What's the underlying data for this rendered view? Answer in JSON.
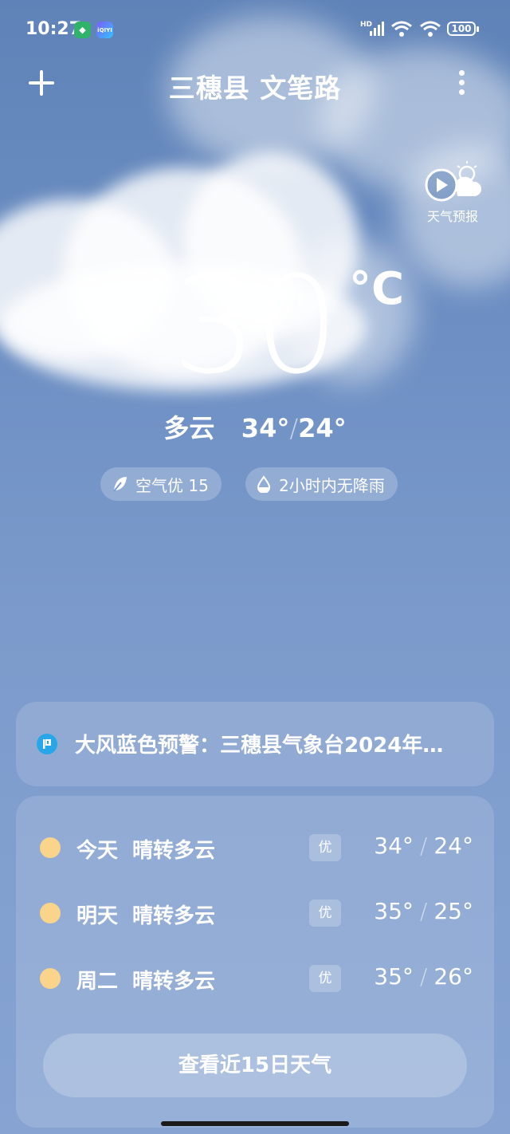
{
  "status_bar": {
    "time": "10:27",
    "app_badges": [
      "shield-app",
      "iQIYI"
    ],
    "signal_label": "HD",
    "battery": "100"
  },
  "header": {
    "location": "三穗县 文笔路"
  },
  "forecast_video": {
    "label": "天气预报"
  },
  "current": {
    "temperature": "30",
    "unit": "°C",
    "condition": "多云",
    "high": "34°",
    "low": "24°"
  },
  "pills": {
    "air": "空气优 15",
    "rain": "2小时内无降雨"
  },
  "alert": {
    "text": "大风蓝色预警：三穗县气象台2024年…"
  },
  "daily": [
    {
      "day": "今天",
      "condition": "晴转多云",
      "aqi": "优",
      "high": "34°",
      "low": "24°"
    },
    {
      "day": "明天",
      "condition": "晴转多云",
      "aqi": "优",
      "high": "35°",
      "low": "25°"
    },
    {
      "day": "周二",
      "condition": "晴转多云",
      "aqi": "优",
      "high": "35°",
      "low": "26°"
    }
  ],
  "more_button": "查看近15日天气",
  "colors": {
    "sky_top": "#5f83b8",
    "sky_bottom": "#86a3d2",
    "sun": "#f9d48a",
    "alert_icon": "#27a6e8"
  }
}
